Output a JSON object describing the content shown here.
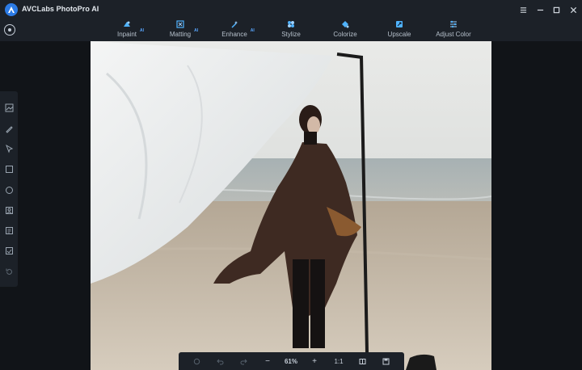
{
  "window": {
    "title": "AVCLabs PhotoPro AI",
    "controls": [
      "menu-icon",
      "minimize-icon",
      "maximize-icon",
      "close-icon"
    ]
  },
  "toolbar": {
    "items": [
      {
        "label": "Inpaint",
        "ai": "AI",
        "icon": "inpaint-icon"
      },
      {
        "label": "Matting",
        "ai": "AI",
        "icon": "matting-icon"
      },
      {
        "label": "Enhance",
        "ai": "AI",
        "icon": "enhance-icon"
      },
      {
        "label": "Stylize",
        "ai": "",
        "icon": "stylize-icon"
      },
      {
        "label": "Colorize",
        "ai": "",
        "icon": "colorize-icon"
      },
      {
        "label": "Upscale",
        "ai": "",
        "icon": "upscale-icon"
      },
      {
        "label": "Adjust Color",
        "ai": "",
        "icon": "adjust-color-icon"
      }
    ]
  },
  "sidebar": {
    "tools": [
      "compare-icon",
      "brush-icon",
      "pointer-icon",
      "rectangle-select-icon",
      "ellipse-select-icon",
      "portrait-select-icon",
      "text-detect-icon",
      "watermark-icon",
      "reset-icon"
    ]
  },
  "bottombar": {
    "zoom_value": "61%",
    "ratio_label": "1:1",
    "minus": "−",
    "plus": "+"
  },
  "colors": {
    "bg": "#111418",
    "panel": "#1c2128",
    "accent": "#59a6ff"
  }
}
